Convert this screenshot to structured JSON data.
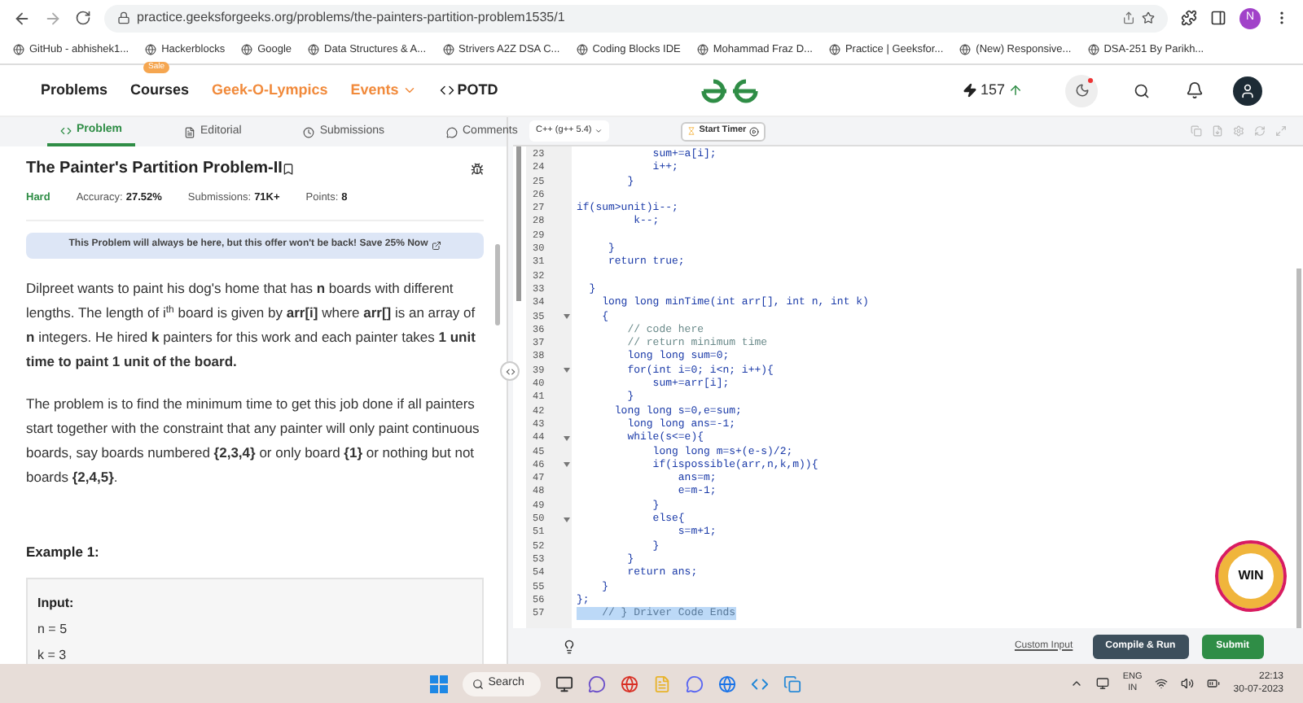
{
  "browser": {
    "url": "practice.geeksforgeeks.org/problems/the-painters-partition-problem1535/1",
    "profile": "N",
    "bookmarks": [
      {
        "label": "GitHub - abhishek1..."
      },
      {
        "label": "Hackerblocks"
      },
      {
        "label": "Google"
      },
      {
        "label": "Data Structures & A..."
      },
      {
        "label": "Strivers A2Z DSA C..."
      },
      {
        "label": "Coding Blocks IDE"
      },
      {
        "label": "Mohammad Fraz D..."
      },
      {
        "label": "Practice | Geeksfor..."
      },
      {
        "label": "(New) Responsive..."
      },
      {
        "label": "DSA-251 By Parikh..."
      }
    ]
  },
  "nav": {
    "items": [
      {
        "label": "Problems",
        "kind": "plain"
      },
      {
        "label": "Courses",
        "kind": "badge",
        "badge": "Sale"
      },
      {
        "label": "Geek-O-Lympics",
        "kind": "highlight"
      },
      {
        "label": "Events",
        "kind": "dropdown"
      },
      {
        "label": "POTD",
        "kind": "code"
      }
    ],
    "streak": "157"
  },
  "tabs": [
    {
      "label": "Problem",
      "selected": true
    },
    {
      "label": "Editorial",
      "selected": false
    },
    {
      "label": "Submissions",
      "selected": false
    },
    {
      "label": "Comments",
      "selected": false
    }
  ],
  "problem": {
    "title": "The Painter's Partition Problem-II",
    "difficulty": "Hard",
    "stats": [
      {
        "label": "Accuracy:",
        "value": "27.52%"
      },
      {
        "label": "Submissions:",
        "value": "71K+"
      },
      {
        "label": "Points:",
        "value": "8"
      }
    ],
    "banner": "This Problem will always be here, but this offer won't be back! Save 25% Now",
    "paragraphs": [
      "Dilpreet wants to paint his dog's home that has **n** boards with different lengths. The length of i$^{th}$ board is given by **arr[i]** where **arr[]** is an array of **n** integers. He hired **k** painters for this work and each painter takes **1 unit time to paint 1 unit of the board.**",
      "The problem is to find the minimum time to get this job done if all painters start together with the constraint that any painter will only paint continuous boards, say boards numbered **{2,3,4}** or only board **{1}** or nothing but not boards **{2,4,5}**."
    ],
    "example_title": "Example 1:",
    "example_heading": "Input:",
    "example_lines": [
      "n = 5",
      "k = 3"
    ]
  },
  "editor": {
    "language": "C++ (g++ 5.4)",
    "timer": "Start Timer",
    "lines": [
      {
        "number": "23",
        "text": "            sum+=a[i];",
        "fold": false,
        "kind": "code"
      },
      {
        "number": "24",
        "text": "            i++;",
        "fold": false,
        "kind": "code"
      },
      {
        "number": "25",
        "text": "        }",
        "fold": false,
        "kind": "code"
      },
      {
        "number": "26",
        "fold": false
      },
      {
        "number": "27",
        "text": "if(sum>unit)i--;",
        "fold": false,
        "kind": "code"
      },
      {
        "number": "28",
        "text": "         k--;",
        "fold": false,
        "kind": "code"
      },
      {
        "number": "29",
        "fold": false
      },
      {
        "number": "30",
        "text": "     }",
        "fold": false,
        "kind": "code"
      },
      {
        "number": "31",
        "text": "     return true;",
        "fold": false,
        "kind": "code"
      },
      {
        "number": "32",
        "fold": false
      },
      {
        "number": "33",
        "text": "  }",
        "fold": false,
        "kind": "code"
      },
      {
        "number": "34",
        "text": "    long long minTime(int arr[], int n, int k)",
        "fold": false,
        "kind": "code"
      },
      {
        "number": "35",
        "text": "    {",
        "fold": true,
        "kind": "code"
      },
      {
        "number": "36",
        "text": "        // code here",
        "fold": false,
        "kind": "comment"
      },
      {
        "number": "37",
        "text": "        // return minimum time",
        "fold": false,
        "kind": "comment"
      },
      {
        "number": "38",
        "text": "        long long sum=0;",
        "fold": false,
        "kind": "code"
      },
      {
        "number": "39",
        "text": "        for(int i=0; i<n; i++){",
        "fold": true,
        "kind": "code"
      },
      {
        "number": "40",
        "text": "            sum+=arr[i];",
        "fold": false,
        "kind": "code"
      },
      {
        "number": "41",
        "text": "        }",
        "fold": false,
        "kind": "code"
      },
      {
        "number": "42",
        "text": "      long long s=0,e=sum;",
        "fold": false,
        "kind": "code"
      },
      {
        "number": "43",
        "text": "        long long ans=-1;",
        "fold": false,
        "kind": "code"
      },
      {
        "number": "44",
        "text": "        while(s<=e){",
        "fold": true,
        "kind": "code"
      },
      {
        "number": "45",
        "text": "            long long m=s+(e-s)/2;",
        "fold": false,
        "kind": "code"
      },
      {
        "number": "46",
        "text": "            if(ispossible(arr,n,k,m)){",
        "fold": true,
        "kind": "code"
      },
      {
        "number": "47",
        "text": "                ans=m;",
        "fold": false,
        "kind": "code"
      },
      {
        "number": "48",
        "text": "                e=m-1;",
        "fold": false,
        "kind": "code"
      },
      {
        "number": "49",
        "text": "            }",
        "fold": false,
        "kind": "code"
      },
      {
        "number": "50",
        "text": "            else{",
        "fold": true,
        "kind": "code"
      },
      {
        "number": "51",
        "text": "                s=m+1;",
        "fold": false,
        "kind": "code"
      },
      {
        "number": "52",
        "text": "            }",
        "fold": false,
        "kind": "code"
      },
      {
        "number": "53",
        "text": "        }",
        "fold": false,
        "kind": "code"
      },
      {
        "number": "54",
        "text": "        return ans;",
        "fold": false,
        "kind": "code"
      },
      {
        "number": "55",
        "text": "    }",
        "fold": false,
        "kind": "code"
      },
      {
        "number": "56",
        "text": "};",
        "fold": false,
        "kind": "code"
      },
      {
        "number": "57",
        "text": "    // } Driver Code Ends",
        "fold": false,
        "kind": "selected"
      }
    ],
    "custom_input": "Custom Input",
    "compile": "Compile & Run",
    "submit": "Submit",
    "badge": "WIN"
  },
  "taskbar": {
    "search": "Search",
    "language": "ENG",
    "region": "IN",
    "time": "22:13",
    "date": "30-07-2023"
  }
}
